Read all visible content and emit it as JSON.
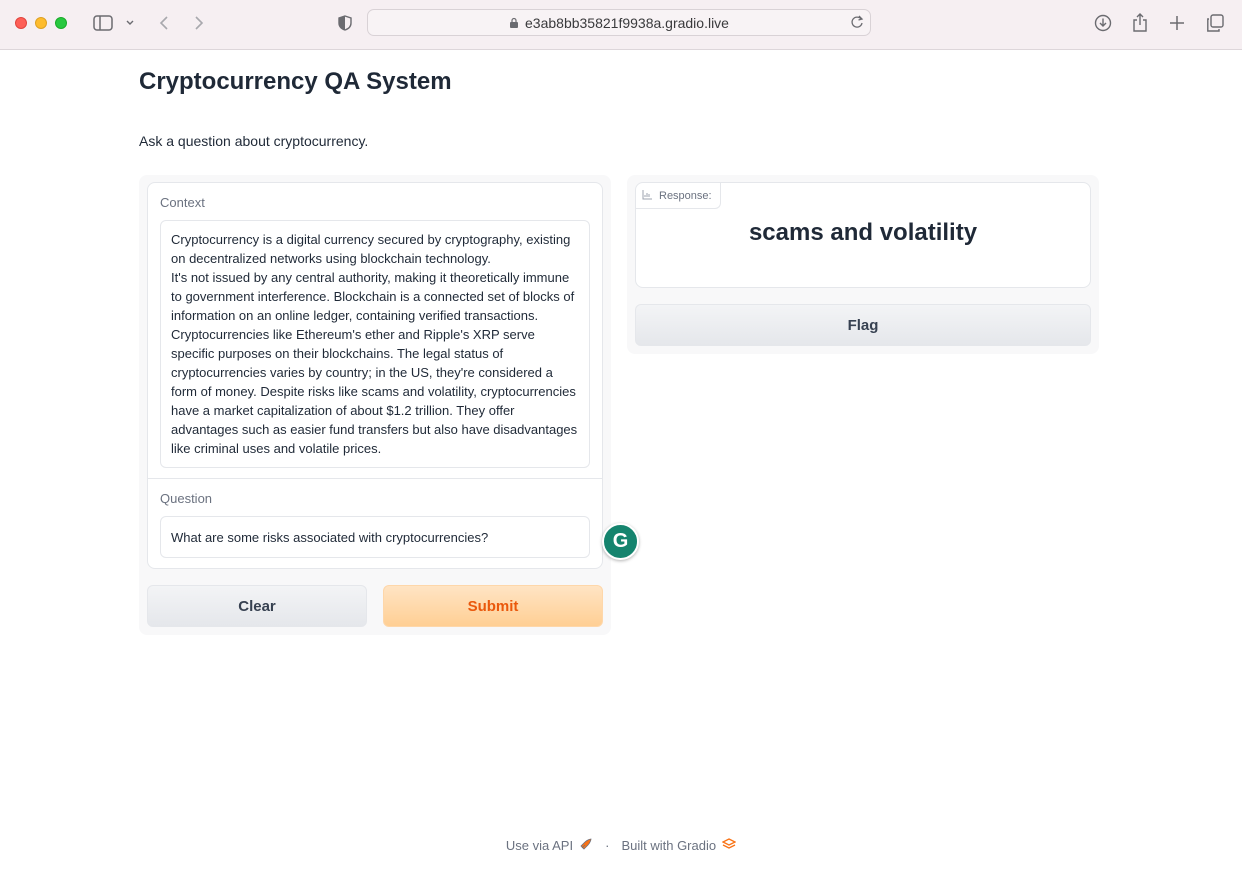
{
  "browser": {
    "url": "e3ab8bb35821f9938a.gradio.live"
  },
  "app": {
    "title": "Cryptocurrency QA System",
    "description": "Ask a question about cryptocurrency."
  },
  "inputs": {
    "context_label": "Context",
    "context_value": "Cryptocurrency is a digital currency secured by cryptography, existing on decentralized networks using blockchain technology.\nIt's not issued by any central authority, making it theoretically immune to government interference. Blockchain is a connected set of blocks of information on an online ledger, containing verified transactions. Cryptocurrencies like Ethereum's ether and Ripple's XRP serve specific purposes on their blockchains. The legal status of cryptocurrencies varies by country; in the US, they're considered a form of money. Despite risks like scams and volatility, cryptocurrencies have a market capitalization of about $1.2 trillion. They offer advantages such as easier fund transfers but also have disadvantages like criminal uses and volatile prices.",
    "question_label": "Question",
    "question_value": "What are some risks associated with cryptocurrencies?"
  },
  "buttons": {
    "clear": "Clear",
    "submit": "Submit",
    "flag": "Flag"
  },
  "output": {
    "label": "Response:",
    "value": "scams and volatility"
  },
  "extension": {
    "grammarly_letter": "G"
  },
  "footer": {
    "api": "Use via API",
    "separator": "·",
    "built": "Built with Gradio"
  },
  "colors": {
    "submit_text": "#ea580c",
    "submit_bg": "#ffd6a5",
    "grammarly": "#15846e"
  }
}
